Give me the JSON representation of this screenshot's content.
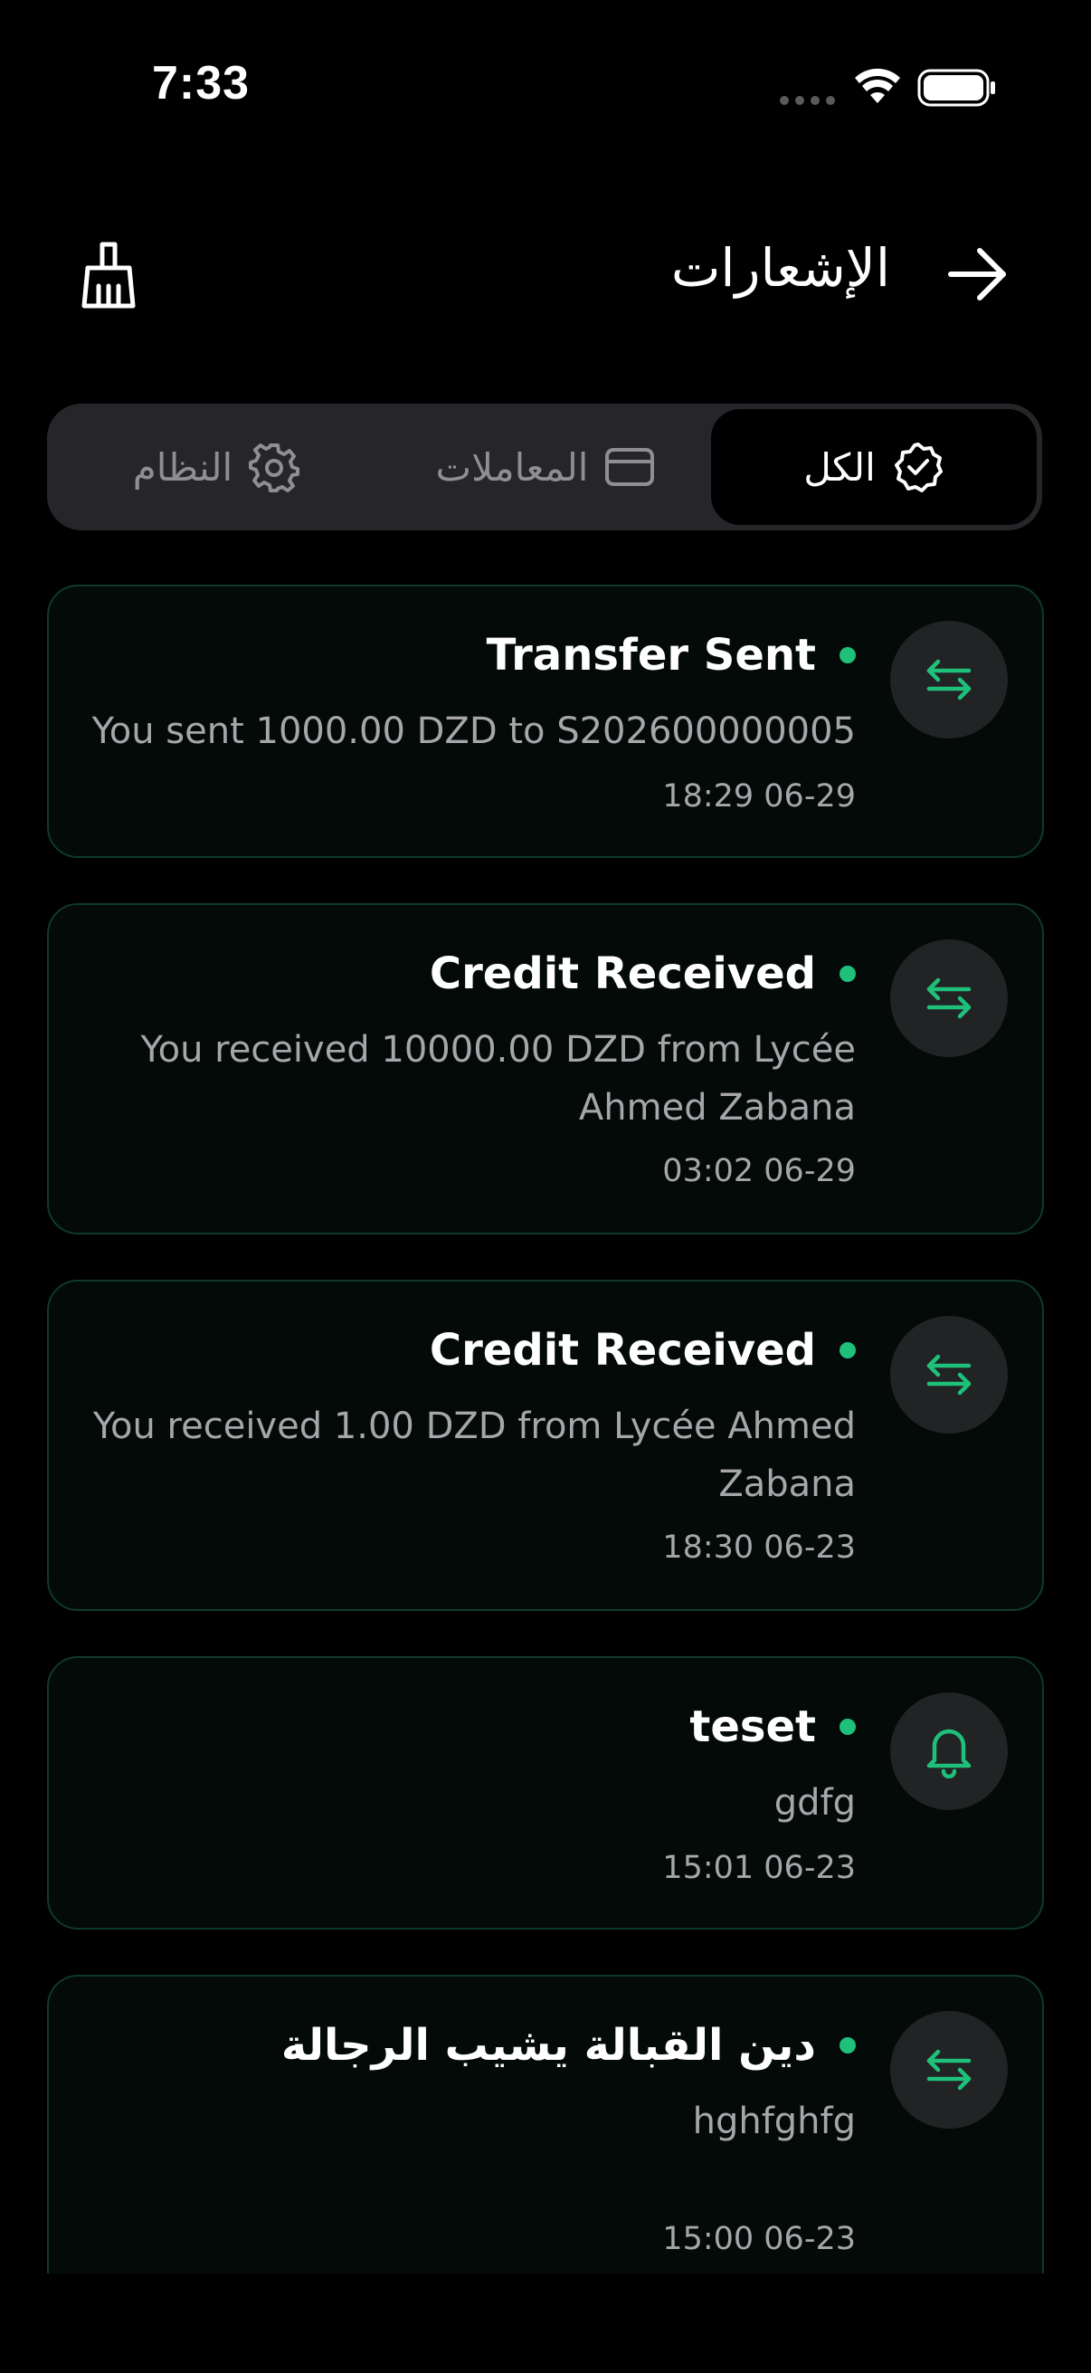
{
  "status_bar": {
    "time": "7:33"
  },
  "header": {
    "title": "الإشعارات",
    "icons": {
      "back": "arrow-right-icon",
      "clear": "broom-icon"
    }
  },
  "tabs": [
    {
      "label": "الكل",
      "icon": "check-badge-icon",
      "active": true
    },
    {
      "label": "المعاملات",
      "icon": "credit-card-icon",
      "active": false
    },
    {
      "label": "النظام",
      "icon": "gear-icon",
      "active": false
    }
  ],
  "notifications": [
    {
      "title": "Transfer Sent",
      "message": "You sent 1000.00 DZD to S202600000005",
      "time": "18:29 06-29",
      "icon": "transfer-arrows-icon",
      "unread": true
    },
    {
      "title": "Credit Received",
      "message": "You received 10000.00 DZD from Lycée Ahmed Zabana",
      "time": "03:02 06-29",
      "icon": "transfer-arrows-icon",
      "unread": true
    },
    {
      "title": "Credit Received",
      "message": "You received 1.00 DZD from Lycée Ahmed Zabana",
      "time": "18:30 06-23",
      "icon": "transfer-arrows-icon",
      "unread": true
    },
    {
      "title": "teset",
      "message": "gdfg",
      "time": "15:01 06-23",
      "icon": "bell-icon",
      "unread": true
    },
    {
      "title": "دين القبالة يشيب الرجالة",
      "message": "hghfghfg",
      "time": "15:00 06-23",
      "icon": "transfer-arrows-icon",
      "unread": true
    }
  ],
  "colors": {
    "background": "#000000",
    "accent": "#1fc07a",
    "card_border": "#0f3a28",
    "muted_text": "#a6a6ab"
  }
}
